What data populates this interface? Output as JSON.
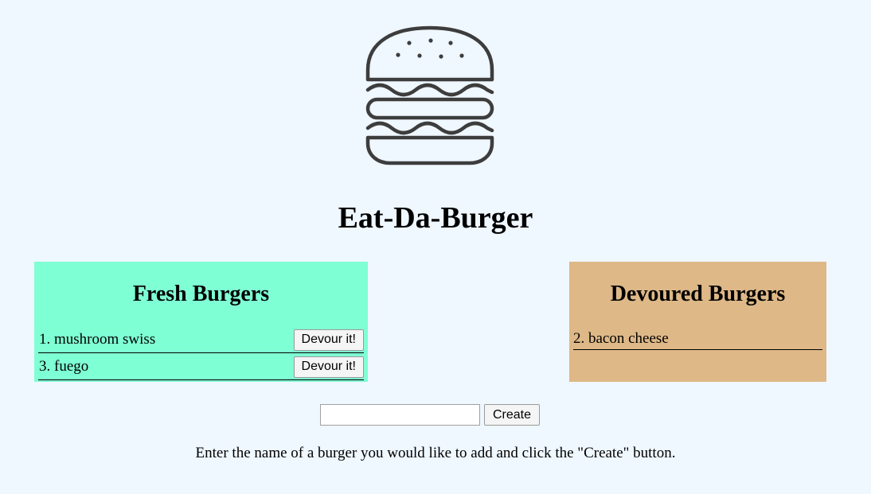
{
  "header": {
    "logo_icon": "burger-icon",
    "title": "Eat-Da-Burger"
  },
  "fresh": {
    "title": "Fresh Burgers",
    "background": "#7fffd4",
    "items": [
      {
        "label": "1. mushroom swiss",
        "button": "Devour it!"
      },
      {
        "label": "3. fuego",
        "button": "Devour it!"
      }
    ]
  },
  "devoured": {
    "title": "Devoured Burgers",
    "background": "#deb887",
    "items": [
      {
        "label": "2. bacon cheese"
      }
    ]
  },
  "form": {
    "input_value": "",
    "create_label": "Create"
  },
  "instructions": "Enter the name of a burger you would like to add and click the \"Create\" button."
}
